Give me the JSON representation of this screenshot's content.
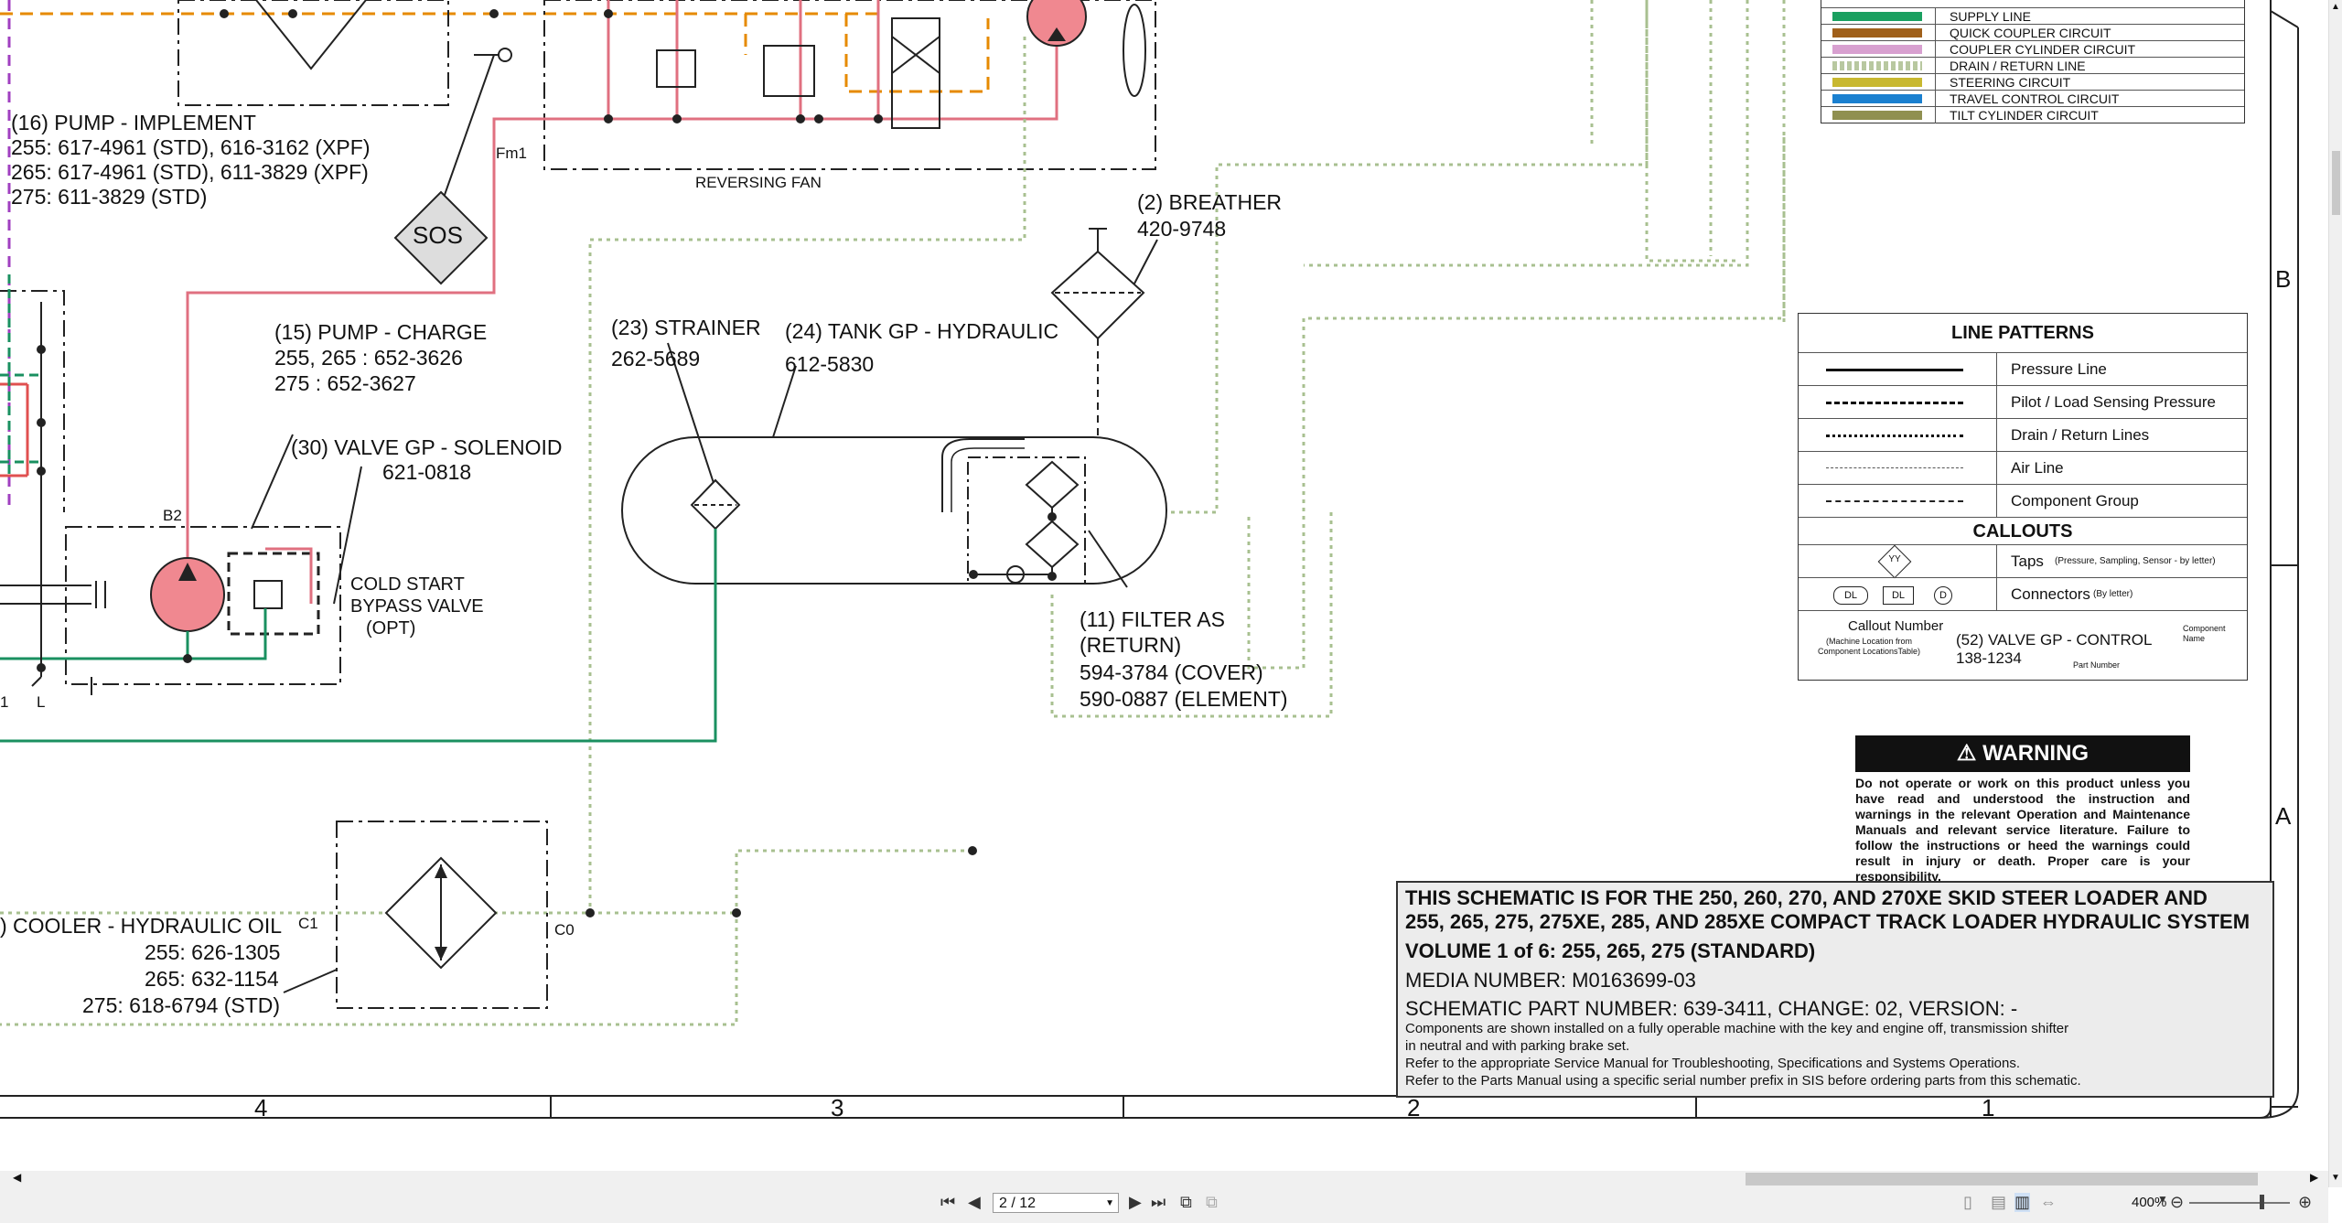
{
  "color_legend": [
    {
      "color": "#1aa060",
      "label": "SUPPLY LINE"
    },
    {
      "color": "#a0601a",
      "label": "QUICK COUPLER CIRCUIT"
    },
    {
      "color": "#d8a0d0",
      "label": "COUPLER CYLINDER CIRCUIT"
    },
    {
      "color": "#b8c8a0",
      "label": "DRAIN / RETURN LINE"
    },
    {
      "color": "#c8b830",
      "label": "STEERING CIRCUIT"
    },
    {
      "color": "#1a80d0",
      "label": "TRAVEL CONTROL CIRCUIT"
    },
    {
      "color": "#909050",
      "label": "TILT CYLINDER CIRCUIT"
    }
  ],
  "line_patterns": {
    "title": "LINE PATTERNS",
    "rows": [
      {
        "label": "Pressure Line",
        "style": "solid"
      },
      {
        "label": "Pilot / Load Sensing Pressure",
        "style": "dashed"
      },
      {
        "label": "Drain / Return Lines",
        "style": "dotted"
      },
      {
        "label": "Air Line",
        "style": "thin-dashed"
      },
      {
        "label": "Component Group",
        "style": "dash-dot"
      }
    ],
    "callouts_title": "CALLOUTS",
    "taps_label": "Taps",
    "taps_note": "(Pressure, Sampling, Sensor - by letter)",
    "taps_symbol": "YY",
    "connectors_label": "Connectors",
    "connectors_note": "(By letter)",
    "connector_symbols": [
      "DL",
      "DL",
      "D"
    ],
    "example": {
      "callout_number": "Callout Number",
      "machine_location": "(Machine Location from Component LocationsTable)",
      "example_name": "(52) VALVE GP - CONTROL",
      "example_part": "138-1234",
      "component_name": "Component Name",
      "part_number": "Part Number"
    }
  },
  "warning": {
    "title": "WARNING",
    "text": "Do not operate or work on this product unless you have read and understood the instruction and warnings in the relevant Operation and Maintenance Manuals and relevant service literature. Failure to follow the instructions or heed the warnings could result in injury or death. Proper care is your responsibility."
  },
  "info": {
    "heading1": "THIS SCHEMATIC IS FOR THE 250, 260, 270, AND 270XE SKID STEER LOADER AND",
    "heading2": "255, 265, 275, 275XE, 285, AND 285XE COMPACT TRACK LOADER HYDRAULIC SYSTEM",
    "volume": "VOLUME 1 of 6: 255, 265, 275 (STANDARD)",
    "media": "MEDIA NUMBER: M0163699-03",
    "part": "SCHEMATIC PART NUMBER: 639-3411, CHANGE: 02, VERSION: -",
    "note1": "Components are shown installed on a fully operable machine with the key and engine off, transmission shifter",
    "note2": "in neutral and with parking brake set.",
    "note3": "Refer to the appropriate Service Manual for Troubleshooting, Specifications and Systems Operations.",
    "note4": "Refer to the Parts Manual using a specific serial number prefix in SIS before ordering parts from this schematic."
  },
  "callouts": {
    "pump_implement": [
      "(16) PUMP - IMPLEMENT",
      "255: 617-4961 (STD), 616-3162 (XPF)",
      "265: 617-4961 (STD), 611-3829 (XPF)",
      "275: 611-3829 (STD)"
    ],
    "pump_charge": [
      "(15) PUMP - CHARGE",
      "255, 265 : 652-3626",
      "275 : 652-3627"
    ],
    "valve_solenoid": [
      "(30) VALVE GP - SOLENOID",
      "621-0818"
    ],
    "cold_start": [
      "COLD START",
      "BYPASS VALVE",
      "(OPT)"
    ],
    "strainer": [
      "(23) STRAINER",
      "262-5689"
    ],
    "tank": [
      "(24) TANK GP - HYDRAULIC",
      "612-5830"
    ],
    "breather": [
      "(2) BREATHER",
      "420-9748"
    ],
    "filter": [
      "(11) FILTER AS",
      "(RETURN)",
      "594-3784 (COVER)",
      "590-0887 (ELEMENT)"
    ],
    "cooler": [
      ") COOLER - HYDRAULIC OIL",
      "255: 626-1305",
      "265: 632-1154",
      "275: 618-6794 (STD)"
    ],
    "reversing_fan": "REVERSING FAN",
    "sos": "SOS",
    "fm1": "Fm1",
    "b2": "B2",
    "c1": "C1",
    "c0": "C0",
    "one": "1",
    "l": "L"
  },
  "zones": {
    "b": "B",
    "a": "A",
    "cols": [
      "4",
      "3",
      "2",
      "1"
    ]
  },
  "toolbar": {
    "page": "2 / 12",
    "zoom": "400%"
  }
}
